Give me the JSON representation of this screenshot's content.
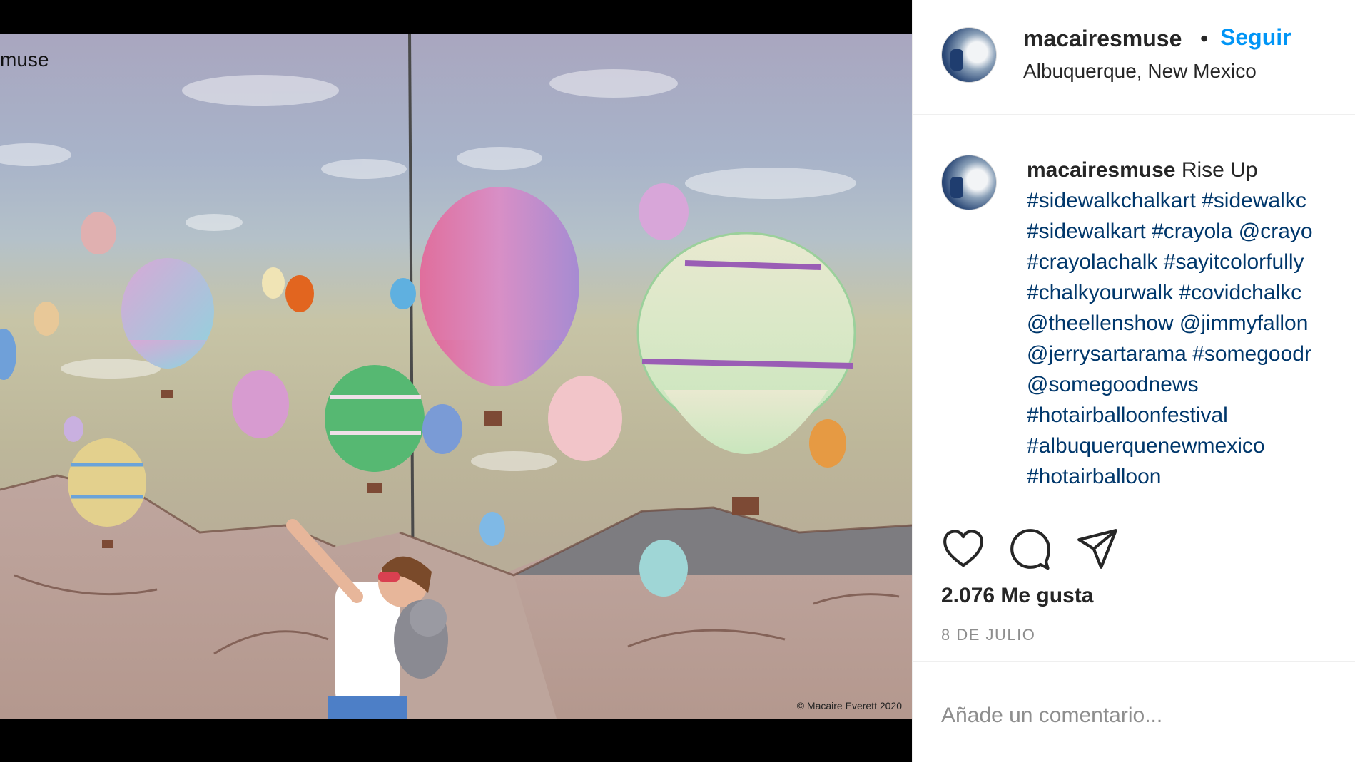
{
  "post": {
    "watermark_user": "muse",
    "copyright": "© Macaire Everett 2020"
  },
  "header": {
    "username": "macairesmuse",
    "separator": "•",
    "follow_label": "Seguir",
    "location": "Albuquerque, New Mexico"
  },
  "caption": {
    "username": "macairesmuse",
    "text": "Rise Up",
    "lines": [
      "#sidewalkchalkart #sidewalkc",
      "#sidewalkart #crayola @crayo",
      "#crayolachalk #sayitcolorfully",
      "#chalkyourwalk #covidchalkc",
      "@theellenshow @jimmyfallon",
      "@jerrysartarama #somegoodr",
      "@somegoodnews",
      "#hotairballoonfestival",
      "#albuquerquenewmexico",
      "#hotairballoon"
    ]
  },
  "actions": {
    "like_icon": "heart-icon",
    "comment_icon": "comment-bubble-icon",
    "share_icon": "paper-plane-icon",
    "likes": "2.076 Me gusta",
    "date": "8 DE JULIO"
  },
  "comment_box": {
    "placeholder": "Añade un comentario..."
  },
  "colors": {
    "link_blue": "#0095f6",
    "hashtag": "#00376b",
    "text": "#262626",
    "muted": "#8e8e8e"
  }
}
